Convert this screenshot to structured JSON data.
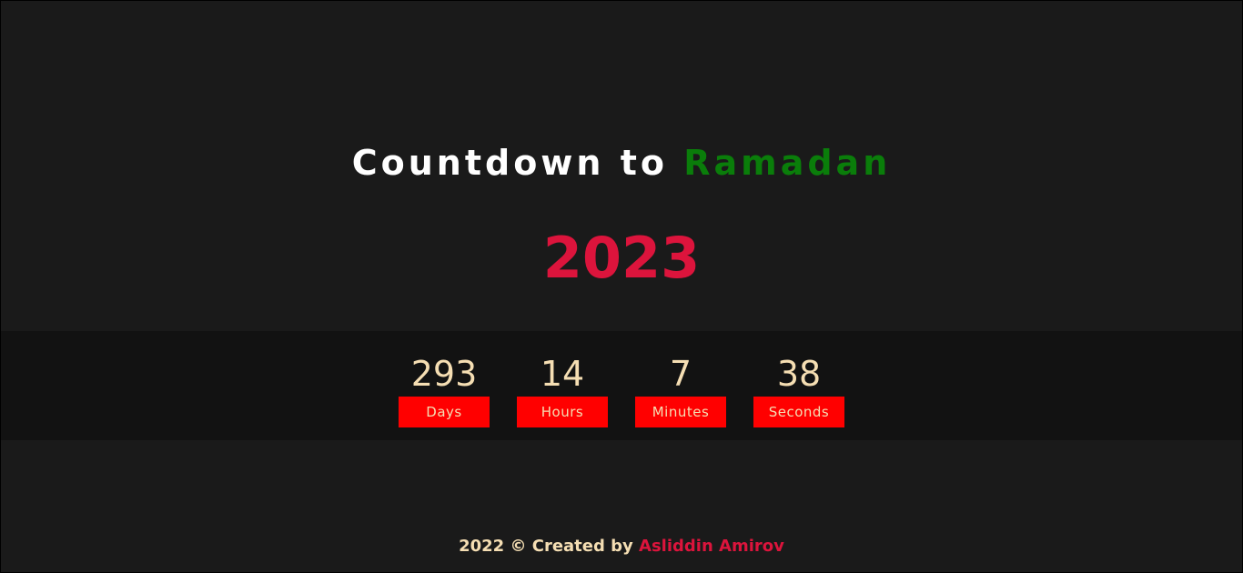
{
  "title": {
    "prefix": "Countdown to ",
    "highlight": "Ramadan"
  },
  "year": "2023",
  "countdown": {
    "units": [
      {
        "value": "293",
        "label": "Days"
      },
      {
        "value": "14",
        "label": "Hours"
      },
      {
        "value": "7",
        "label": "Minutes"
      },
      {
        "value": "38",
        "label": "Seconds"
      }
    ]
  },
  "footer": {
    "text": "2022 © Created by ",
    "author": "Asliddin Amirov"
  },
  "colors": {
    "background": "#1a1a1a",
    "band": "#121212",
    "title": "#ffffff",
    "title_accent": "#0a7d0a",
    "year": "#dc143c",
    "numbers": "#f5deb3",
    "label_bg": "#ff0000",
    "author": "#dc143c"
  }
}
